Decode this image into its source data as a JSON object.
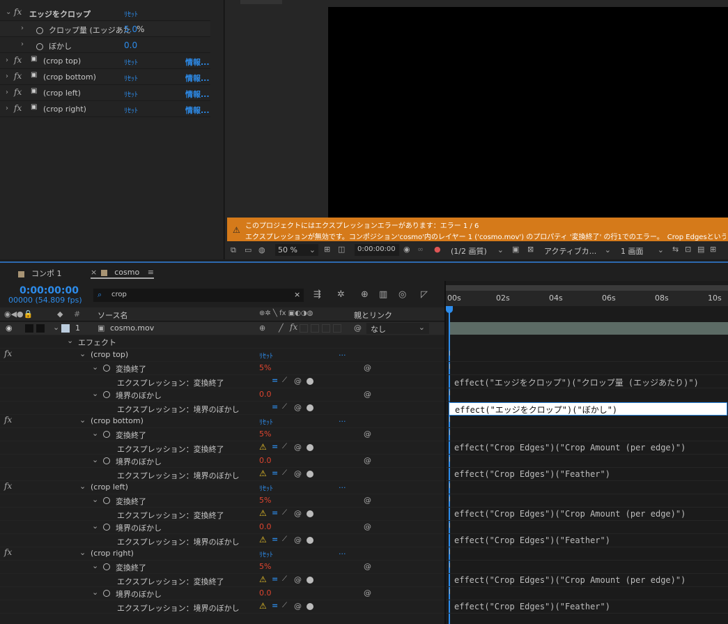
{
  "effects_panel": {
    "main_effect": {
      "name": "エッジをクロップ",
      "reset": "ﾘｾｯﾄ"
    },
    "props": [
      {
        "label": "クロップ量 (エッジあた",
        "value": "5.0",
        "unit": "%"
      },
      {
        "label": "ぼかし",
        "value": "0.0"
      }
    ],
    "sub_effects": [
      {
        "name": "(crop top)",
        "reset": "ﾘｾｯﾄ",
        "info": "情報..."
      },
      {
        "name": "(crop bottom)",
        "reset": "ﾘｾｯﾄ",
        "info": "情報..."
      },
      {
        "name": "(crop left)",
        "reset": "ﾘｾｯﾄ",
        "info": "情報..."
      },
      {
        "name": "(crop right)",
        "reset": "ﾘｾｯﾄ",
        "info": "情報..."
      }
    ],
    "fx_label": "fx"
  },
  "viewer": {
    "tab": "cosmo",
    "error_line1": "このプロジェクトにはエクスプレッションエラーがあります：エラー 1 / 6",
    "error_line2": "エクスプレッションが無効です。コンポジション'cosmo'内のレイヤー 1 ('cosmo.mov') のプロパティ '変換終了' の行1でのエラー。　Crop Edgesという名",
    "toolbar": {
      "zoom": "50 %",
      "timecode": "0:00:00:00",
      "resolution": "(1/2 画質)",
      "camera": "アクティブカ...",
      "views": "1 画面"
    }
  },
  "timeline": {
    "tabs": [
      {
        "label": "コンポ 1"
      },
      {
        "label": "cosmo"
      }
    ],
    "timecode": "0:00:00:00",
    "frames_fps": "00000 (54.809 fps)",
    "search_value": "crop",
    "header": {
      "source_name": "ソース名",
      "parent_link": "親とリンク",
      "number": "#"
    },
    "ruler": [
      "00s",
      "02s",
      "04s",
      "06s",
      "08s",
      "10s"
    ],
    "layer": {
      "num": "1",
      "name": "cosmo.mov",
      "parent": "なし"
    },
    "effects_group": "エフェクト",
    "blocks": [
      {
        "name": "(crop top)",
        "reset": "ﾘｾｯﾄ",
        "more": "...",
        "p1": "変換終了",
        "v1": "5%",
        "e1": "エクスプレッション：変換終了",
        "w1": false,
        "p2": "境界のぼかし",
        "v2": "0.0",
        "e2": "エクスプレッション：境界のぼかし",
        "w2": false,
        "x1": "effect(\"エッジをクロップ\")(\"クロップ量 (エッジあたり)\")",
        "x2": "effect(\"エッジをクロップ\")(\"ぼかし\")"
      },
      {
        "name": "(crop bottom)",
        "reset": "ﾘｾｯﾄ",
        "more": "...",
        "p1": "変換終了",
        "v1": "5%",
        "e1": "エクスプレッション：変換終了",
        "w1": true,
        "p2": "境界のぼかし",
        "v2": "0.0",
        "e2": "エクスプレッション：境界のぼかし",
        "w2": true,
        "x1": "effect(\"Crop Edges\")(\"Crop Amount (per edge)\")",
        "x2": "effect(\"Crop Edges\")(\"Feather\")"
      },
      {
        "name": "(crop left)",
        "reset": "ﾘｾｯﾄ",
        "more": "...",
        "p1": "変換終了",
        "v1": "5%",
        "e1": "エクスプレッション：変換終了",
        "w1": true,
        "p2": "境界のぼかし",
        "v2": "0.0",
        "e2": "エクスプレッション：境界のぼかし",
        "w2": true,
        "x1": "effect(\"Crop Edges\")(\"Crop Amount (per edge)\")",
        "x2": "effect(\"Crop Edges\")(\"Feather\")"
      },
      {
        "name": "(crop right)",
        "reset": "ﾘｾｯﾄ",
        "more": "...",
        "p1": "変換終了",
        "v1": "5%",
        "e1": "エクスプレッション：変換終了",
        "w1": true,
        "p2": "境界のぼかし",
        "v2": "0.0",
        "e2": "エクスプレッション：境界のぼかし",
        "w2": true,
        "x1": "effect(\"Crop Edges\")(\"Crop Amount (per edge)\")",
        "x2": "effect(\"Crop Edges\")(\"Feather\")"
      }
    ]
  },
  "colors": {
    "accent": "#2d8ceb",
    "error_bar": "#d57a1a",
    "value_red": "#e0452f"
  }
}
